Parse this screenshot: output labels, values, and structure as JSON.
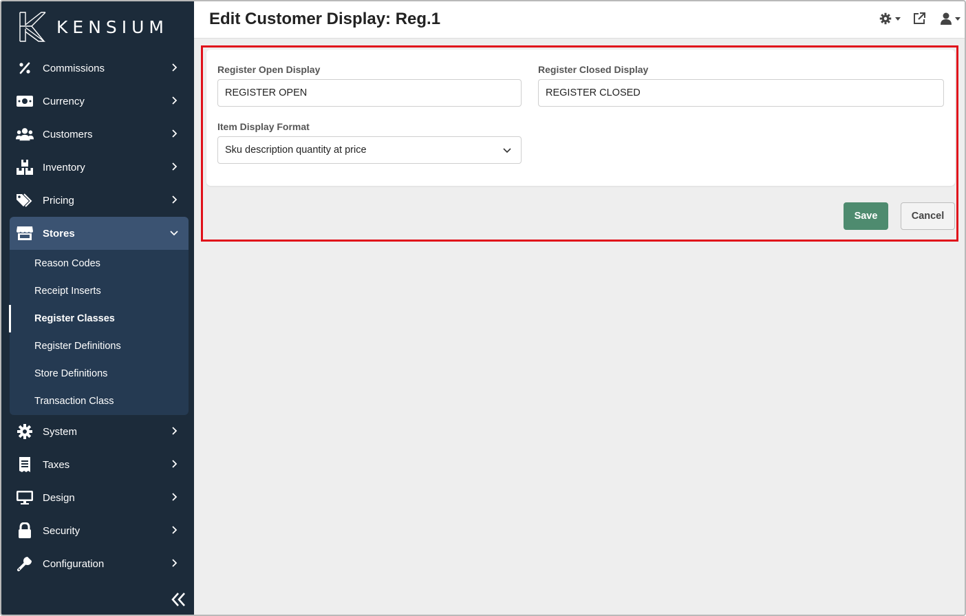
{
  "brand": {
    "name": "KENSIUM"
  },
  "header": {
    "title": "Edit Customer Display: Reg.1"
  },
  "sidebar": {
    "items": [
      {
        "label": "Commissions",
        "icon": "percent-icon"
      },
      {
        "label": "Currency",
        "icon": "money-icon"
      },
      {
        "label": "Customers",
        "icon": "users-icon"
      },
      {
        "label": "Inventory",
        "icon": "boxes-icon"
      },
      {
        "label": "Pricing",
        "icon": "tags-icon"
      },
      {
        "label": "Stores",
        "icon": "store-icon"
      },
      {
        "label": "System",
        "icon": "gear-icon"
      },
      {
        "label": "Taxes",
        "icon": "receipt-icon"
      },
      {
        "label": "Design",
        "icon": "monitor-icon"
      },
      {
        "label": "Security",
        "icon": "lock-icon"
      },
      {
        "label": "Configuration",
        "icon": "wrench-icon"
      }
    ],
    "stores_submenu": [
      {
        "label": "Reason Codes"
      },
      {
        "label": "Receipt Inserts"
      },
      {
        "label": "Register Classes"
      },
      {
        "label": "Register Definitions"
      },
      {
        "label": "Store Definitions"
      },
      {
        "label": "Transaction Class"
      }
    ]
  },
  "form": {
    "open_label": "Register Open Display",
    "open_value": "REGISTER OPEN",
    "closed_label": "Register Closed Display",
    "closed_value": "REGISTER CLOSED",
    "format_label": "Item Display Format",
    "format_value": "Sku description quantity at price"
  },
  "actions": {
    "save": "Save",
    "cancel": "Cancel"
  },
  "colors": {
    "sidebar": "#1c2b3a",
    "active": "#3b5372",
    "submenu": "#253a52",
    "save": "#4e8b6f",
    "highlight": "#e0101a"
  }
}
